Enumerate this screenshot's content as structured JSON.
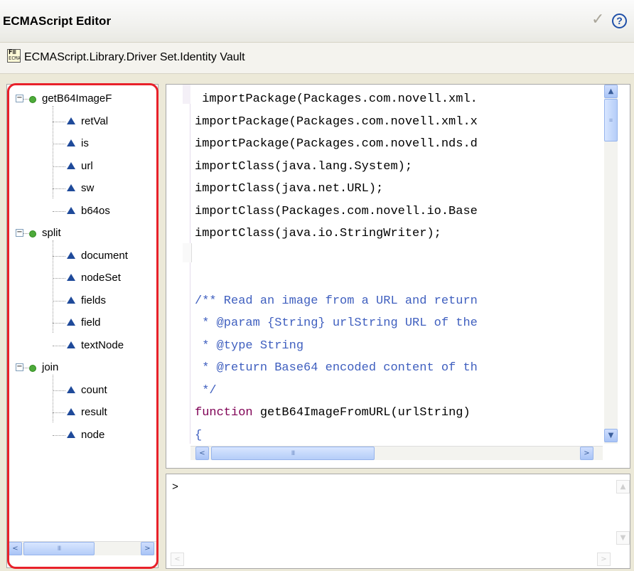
{
  "header": {
    "title": "ECMAScript Editor",
    "check_icon": "checkmark-icon",
    "help_icon": "help-icon",
    "help_glyph": "?"
  },
  "path": {
    "icon": "ecmascript-file-icon",
    "icon_top": "F≡",
    "icon_bottom": "ECMA",
    "text": "ECMAScript.Library.Driver Set.Identity Vault"
  },
  "outline": {
    "functions": [
      {
        "name": "getB64ImageF",
        "variables": [
          "retVal",
          "is",
          "url",
          "sw",
          "b64os"
        ]
      },
      {
        "name": "split",
        "variables": [
          "document",
          "nodeSet",
          "fields",
          "field",
          "textNode"
        ]
      },
      {
        "name": "join",
        "variables": [
          "count",
          "result",
          "node"
        ]
      }
    ],
    "expander_glyph": "−",
    "scroll_left": "<",
    "scroll_right": ">",
    "thumb_grip": "III"
  },
  "editor": {
    "lines": [
      {
        "text": " importPackage(Packages.com.novell.xml.",
        "style": "plain"
      },
      {
        "text": "importPackage(Packages.com.novell.xml.x",
        "style": "plain"
      },
      {
        "text": "importPackage(Packages.com.novell.nds.d",
        "style": "plain"
      },
      {
        "text": "importClass(java.lang.System);",
        "style": "plain"
      },
      {
        "text": "importClass(java.net.URL);",
        "style": "plain"
      },
      {
        "text": "importClass(Packages.com.novell.io.Base",
        "style": "plain"
      },
      {
        "text": "importClass(java.io.StringWriter);",
        "style": "plain"
      },
      {
        "text": "",
        "style": "plain"
      },
      {
        "text": "",
        "style": "plain"
      },
      {
        "text": "/** Read an image from a URL and return",
        "style": "comment"
      },
      {
        "text": " * @param {String} urlString URL of the",
        "style": "comment"
      },
      {
        "text": " * @type String",
        "style": "comment"
      },
      {
        "text": " * @return Base64 encoded content of th",
        "style": "comment"
      },
      {
        "text": " */",
        "style": "comment"
      },
      {
        "text": "function getB64ImageFromURL(urlString)",
        "style": "function"
      },
      {
        "text": "{",
        "style": "brace"
      }
    ],
    "keyword": "function",
    "scroll_up": "▲",
    "scroll_down": "▼",
    "scroll_left": "<",
    "scroll_right": ">",
    "thumb_grip": "III",
    "vthumb_grip": "≡"
  },
  "console": {
    "prompt": ">",
    "scroll_up": "▲",
    "scroll_down": "▼",
    "scroll_left": "<",
    "scroll_right": ">"
  },
  "colors": {
    "highlight_border": "#e8212a",
    "function_dot": "#4daa3a",
    "variable_triangle": "#1f4a9a",
    "comment": "#3f5fbf",
    "keyword": "#7f0055"
  }
}
